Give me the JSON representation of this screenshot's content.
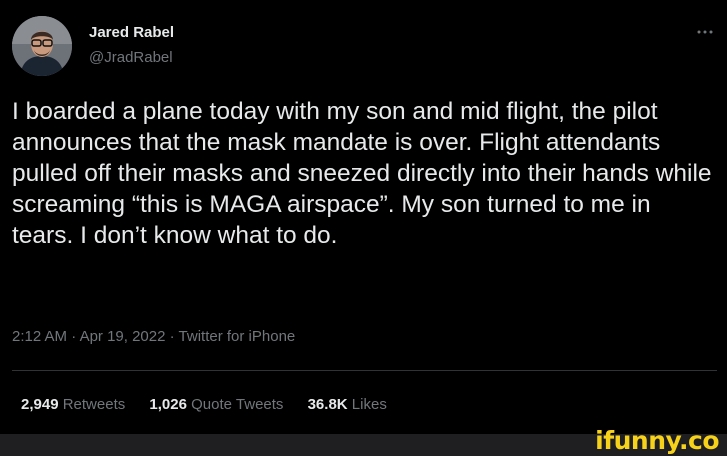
{
  "author": {
    "name": "Jared Rabel",
    "handle": "@JradRabel"
  },
  "more_icon": "more-horizontal-icon",
  "tweet": {
    "text": "I boarded a plane today with my son and mid flight, the pilot announces that the mask mandate is over. Flight attendants pulled off their masks and sneezed directly into their hands while screaming “this is MAGA airspace”. My son turned to me in tears. I don’t know what to do.",
    "time": "2:12 AM",
    "date": "Apr 19, 2022",
    "source": "Twitter for iPhone",
    "separator": "·"
  },
  "stats": {
    "retweets_count": "2,949",
    "retweets_label": "Retweets",
    "quote_tweets_count": "1,026",
    "quote_tweets_label": "Quote Tweets",
    "likes_count": "36.8K",
    "likes_label": "Likes"
  },
  "watermark": {
    "text": "ifunny.co"
  },
  "colors": {
    "background": "#000000",
    "primary_text": "#e7e9ea",
    "secondary_text": "#71767b",
    "watermark": "#f7d21a"
  }
}
